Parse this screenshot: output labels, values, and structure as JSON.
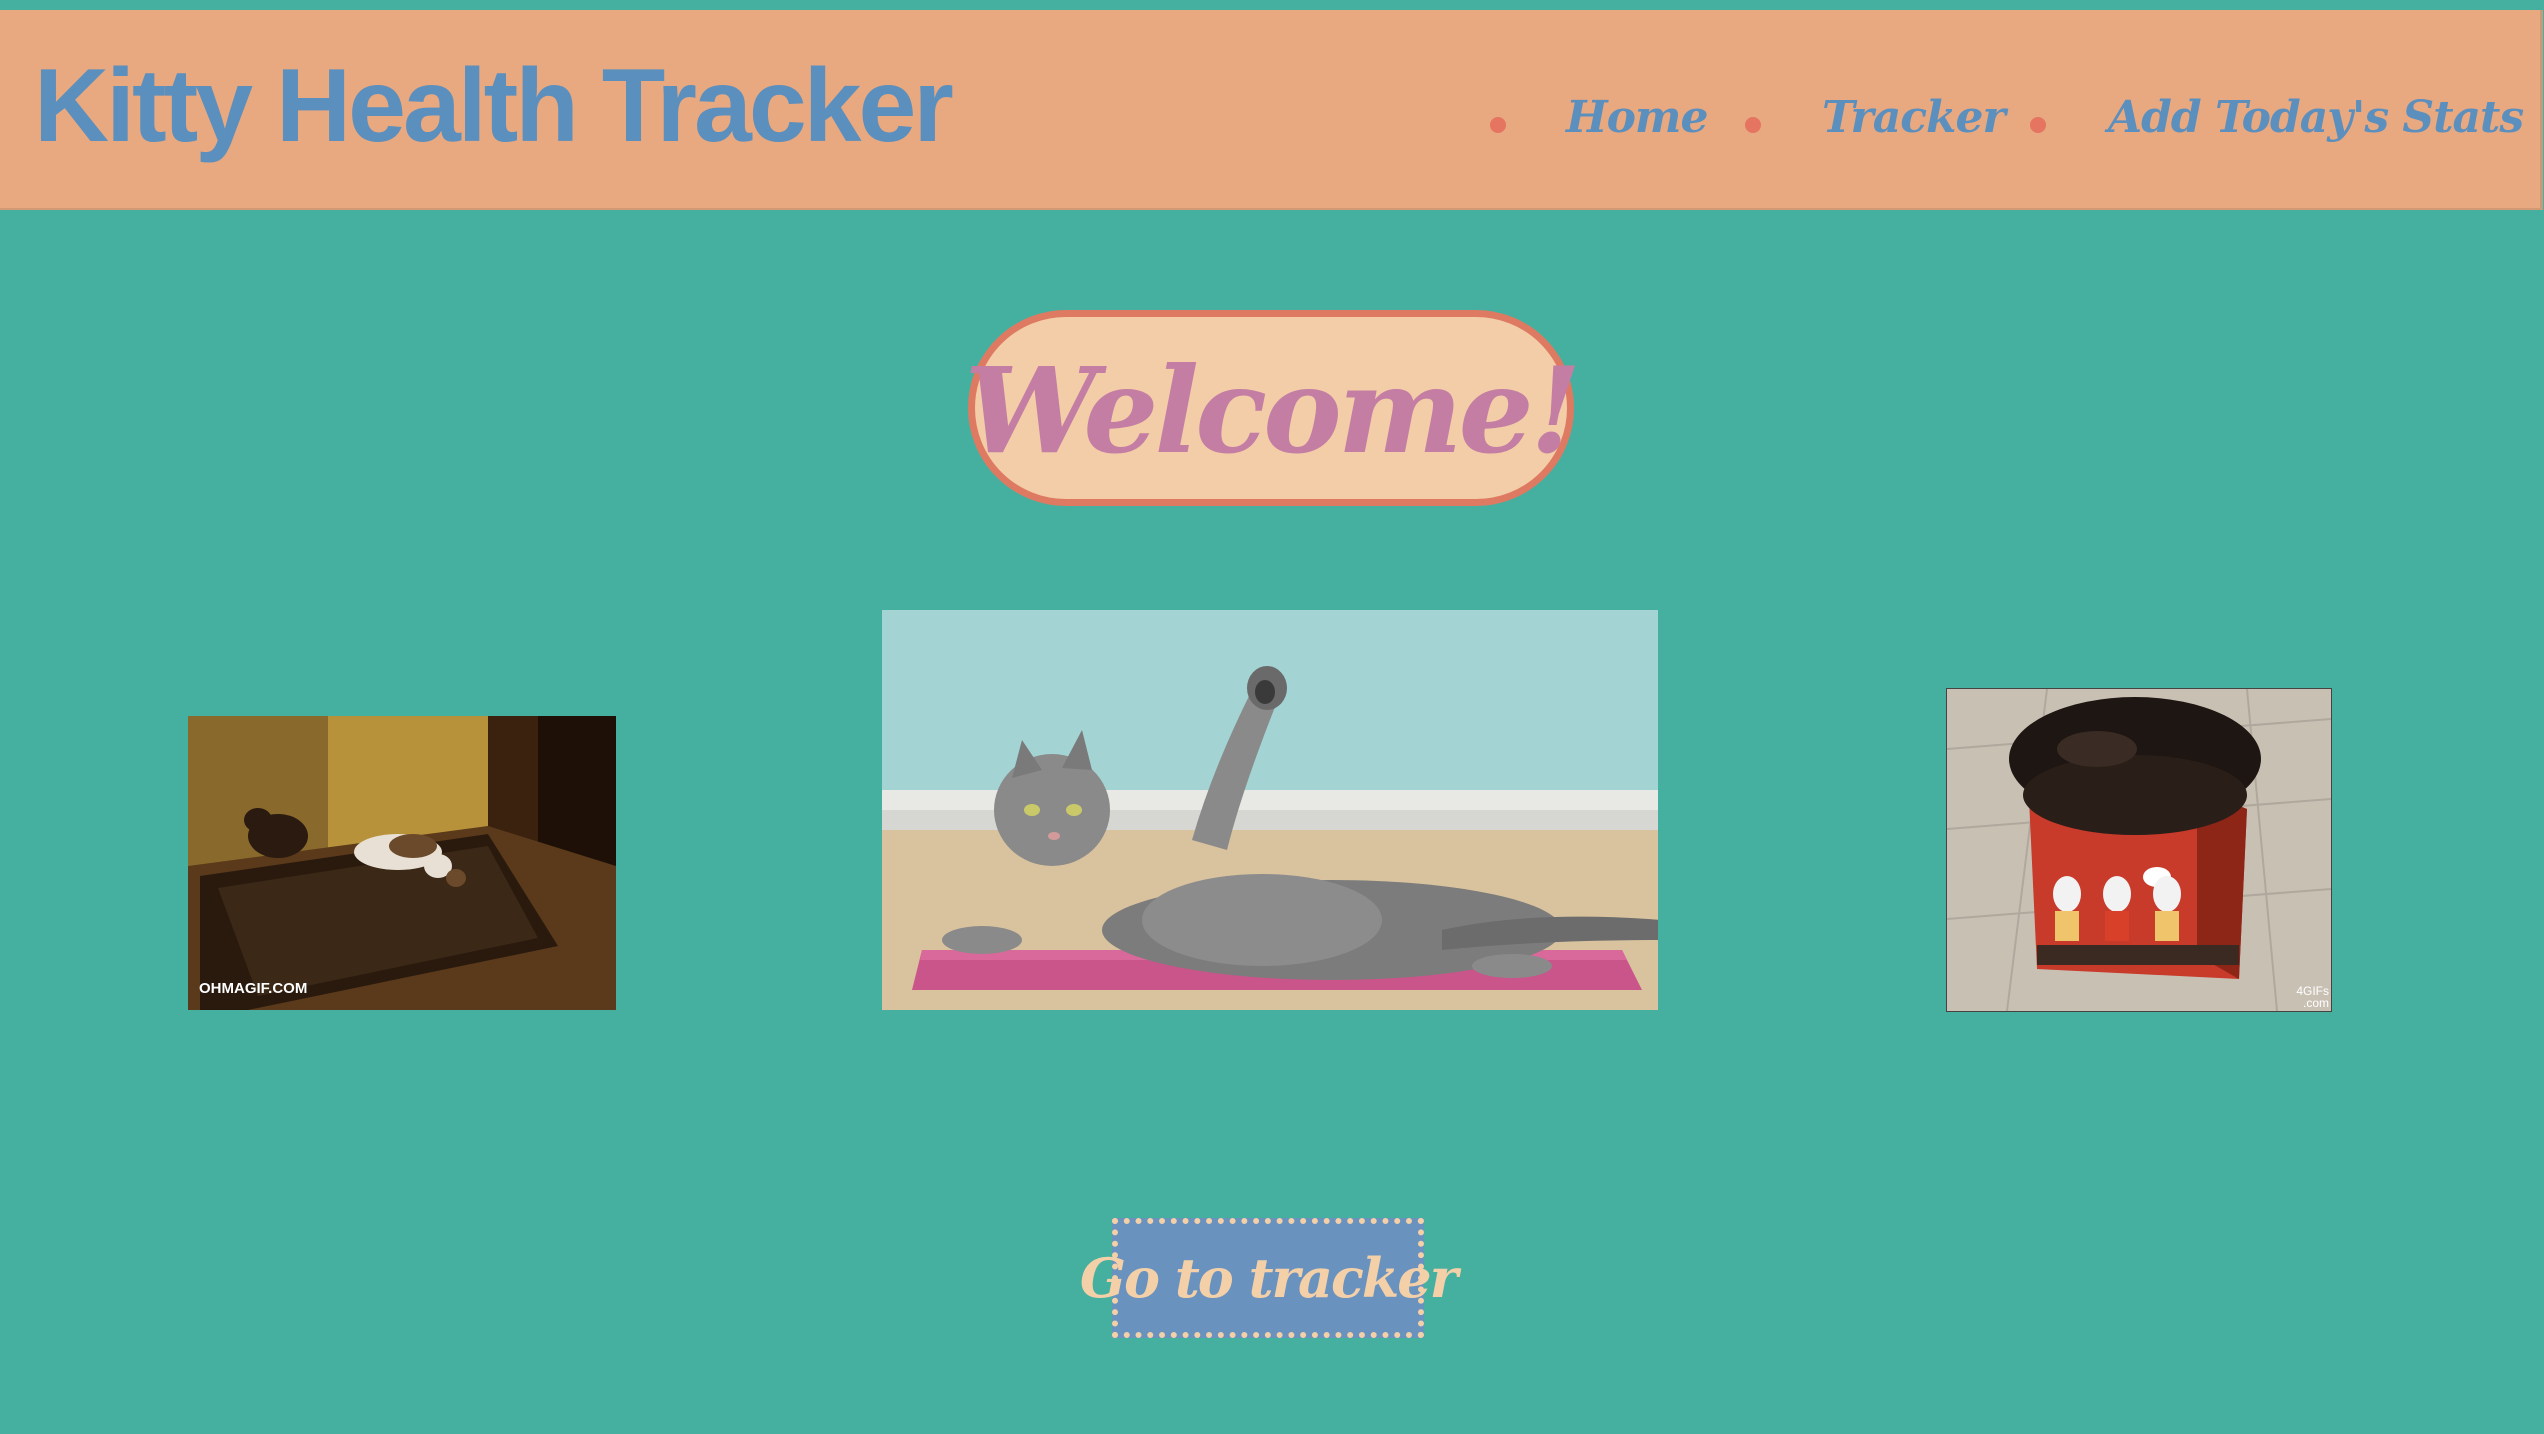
{
  "header": {
    "brand": "Kitty Health Tracker",
    "nav": [
      {
        "label": "Home"
      },
      {
        "label": "Tracker"
      },
      {
        "label": "Add Today's Stats"
      }
    ]
  },
  "main": {
    "welcome": "Welcome!",
    "gifs": [
      {
        "name": "cats-on-treadmill",
        "caption": "OHMAGIF.COM"
      },
      {
        "name": "cat-yoga-mat",
        "caption": ""
      },
      {
        "name": "cat-in-box",
        "caption": "4GIFs\n.com"
      }
    ],
    "cta_label": "Go to tracker"
  },
  "colors": {
    "background": "#45b0a0",
    "header": "#e8a880",
    "brand_text": "#5b8fbe",
    "nav_bullet": "#e57460",
    "welcome_fill": "#f2cda8",
    "welcome_border": "#de7a62",
    "welcome_text": "#c47ea4",
    "button_fill": "#6a92bf",
    "button_text": "#f3d0a8"
  }
}
